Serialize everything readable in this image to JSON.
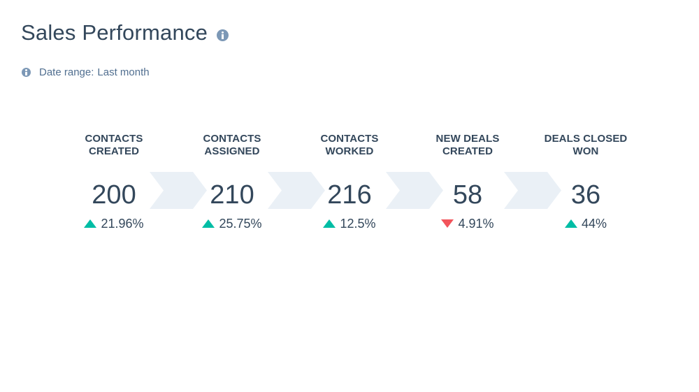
{
  "header": {
    "title": "Sales Performance",
    "title_icon": "info-icon"
  },
  "date_range": {
    "icon": "info-icon",
    "label": "Date range:",
    "value": "Last month"
  },
  "colors": {
    "text": "#33475b",
    "icon": "#7c98b6",
    "chevron": "#eaf0f6",
    "positive": "#00bda5",
    "negative": "#f2545b"
  },
  "stages": [
    {
      "label_line1": "CONTACTS",
      "label_line2": "CREATED",
      "value": "200",
      "change": "21.96%",
      "direction": "up"
    },
    {
      "label_line1": "CONTACTS",
      "label_line2": "ASSIGNED",
      "value": "210",
      "change": "25.75%",
      "direction": "up"
    },
    {
      "label_line1": "CONTACTS",
      "label_line2": "WORKED",
      "value": "216",
      "change": "12.5%",
      "direction": "up"
    },
    {
      "label_line1": "NEW DEALS",
      "label_line2": "CREATED",
      "value": "58",
      "change": "4.91%",
      "direction": "down"
    },
    {
      "label_line1": "DEALS CLOSED",
      "label_line2": "WON",
      "value": "36",
      "change": "44%",
      "direction": "up"
    }
  ]
}
